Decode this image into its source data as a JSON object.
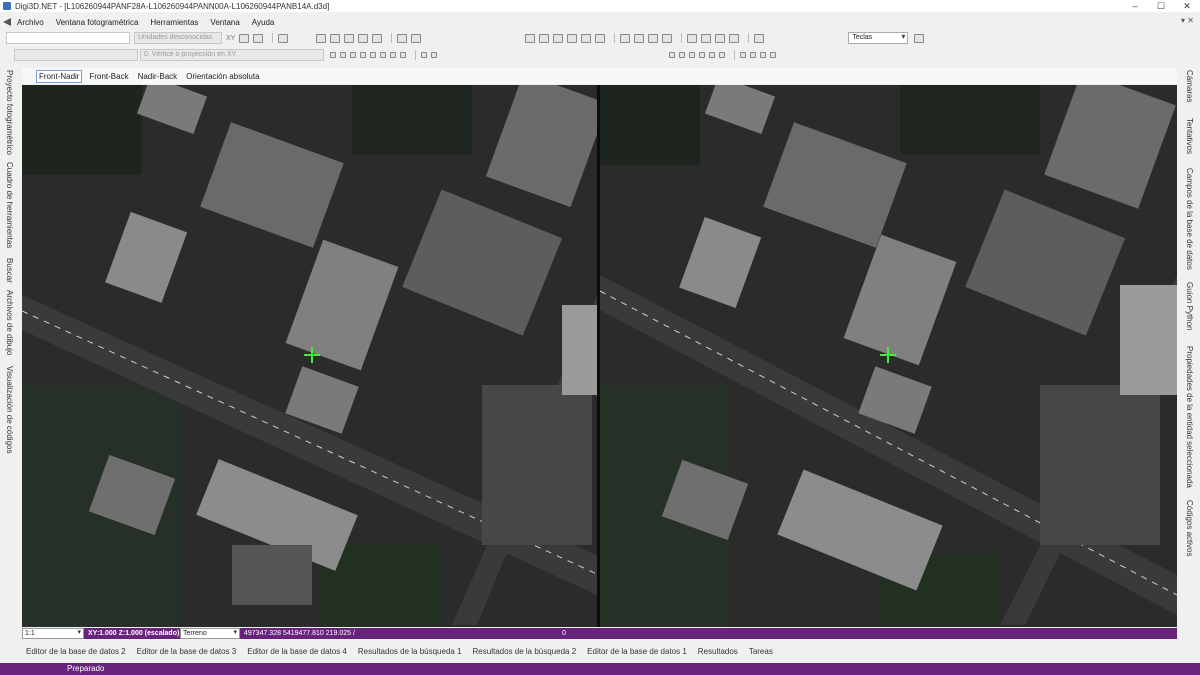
{
  "window": {
    "title": "Digi3D.NET - [L106260944PANF28A-L106260944PANN00A-L106260944PANB14A.d3d]",
    "controls": [
      "–",
      "☐",
      "✕"
    ]
  },
  "menu": {
    "items": [
      "Archivo",
      "Ventana fotogramétrica",
      "Herramientas",
      "Ventana",
      "Ayuda"
    ],
    "right_controls": "▾ ✕"
  },
  "toolbar1": {
    "units_placeholder": "Unidades desconocidas",
    "xy_label": "XY",
    "keys_combo": "Teclas"
  },
  "toolbar2": {
    "snap_placeholder": "0. Vértice o proyección en XY."
  },
  "left_dock": {
    "tabs": [
      "Proyecto fotogramétrico",
      "Cuadro de herramientas",
      "Buscar",
      "Archivos de dibujo",
      "Visualización de códigos"
    ]
  },
  "right_dock": {
    "tabs": [
      "Cámaras",
      "Tentativos",
      "Campos de la base de datos",
      "Guion Python",
      "Propiedades de la entidad seleccionada",
      "Códigos activos"
    ]
  },
  "view_tabs": {
    "items": [
      "Front-Nadir",
      "Front-Back",
      "Nadir-Back",
      "Orientación absoluta"
    ],
    "active": "Front-Nadir"
  },
  "view_status": {
    "zoom": "1:1",
    "scale": "XY:1.000 Z:1.000 (escalado)",
    "terrain": "Terreno",
    "coords": "497347.328 5419477.810 219.025 /",
    "z_value": "0"
  },
  "bottom_tabs": {
    "items": [
      "Editor de la base de datos 2",
      "Editor de la base de datos 3",
      "Editor de la base de datos 4",
      "Resultados de la búsqueda 1",
      "Resultados de la búsqueda 2",
      "Editor de la base de datos 1",
      "Resultados",
      "Tareas"
    ]
  },
  "status": {
    "text": "Preparado"
  },
  "colors": {
    "accent_purple": "#68237a",
    "cursor_green": "#3bf03b"
  }
}
